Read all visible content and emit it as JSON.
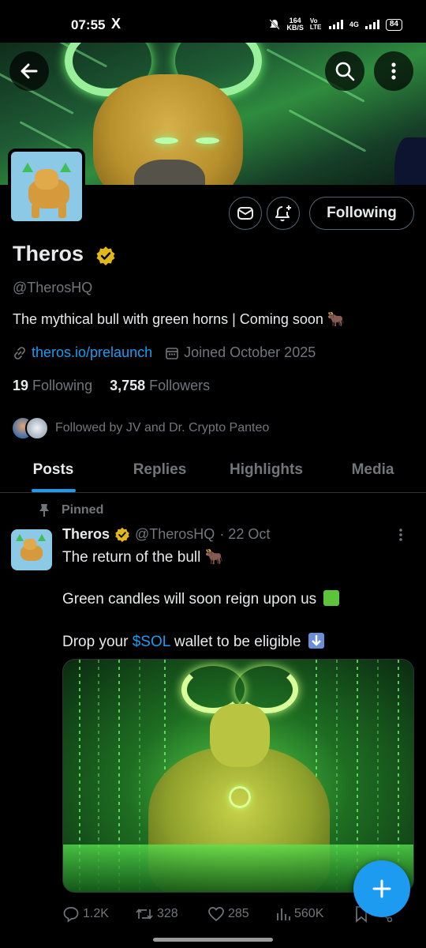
{
  "status_bar": {
    "time": "07:55",
    "app_icon": "X",
    "net_speed_value": "164",
    "net_speed_unit": "KB/S",
    "volte": "Vo LTE",
    "network": "4G",
    "battery": "84"
  },
  "profile": {
    "display_name": "Theros",
    "handle": "@TherosHQ",
    "bio": "The mythical bull with green horns | Coming soon 🐂",
    "website": "theros.io/prelaunch",
    "joined": "Joined October 2025",
    "following_count": "19",
    "following_label": "Following",
    "followers_count": "3,758",
    "followers_label": "Followers",
    "followed_by": "Followed by JV and Dr. Crypto Panteo",
    "follow_button_label": "Following"
  },
  "tabs": [
    {
      "label": "Posts",
      "active": true
    },
    {
      "label": "Replies",
      "active": false
    },
    {
      "label": "Highlights",
      "active": false
    },
    {
      "label": "Media",
      "active": false
    }
  ],
  "post": {
    "pinned_label": "Pinned",
    "author": "Theros",
    "handle": "@TherosHQ",
    "date": "· 22 Oct",
    "line1": "The return of the bull 🐂",
    "line2": "Green candles will soon reign upon us",
    "line3_before": "Drop your ",
    "line3_tag": "$SOL",
    "line3_after": " wallet to be eligible",
    "replies": "1.2K",
    "reposts": "328",
    "likes": "285",
    "views": "560K"
  },
  "colors": {
    "accent": "#1d9bf0",
    "verified": "#e2b719",
    "muted": "#71767b",
    "text": "#e7e9ea"
  },
  "icons": [
    "back-arrow-icon",
    "search-icon",
    "more-vertical-icon",
    "mail-icon",
    "bell-plus-icon",
    "verified-badge-icon",
    "link-icon",
    "calendar-icon",
    "pin-icon",
    "reply-icon",
    "repost-icon",
    "like-icon",
    "views-icon",
    "bookmark-icon",
    "share-icon",
    "plus-icon"
  ]
}
